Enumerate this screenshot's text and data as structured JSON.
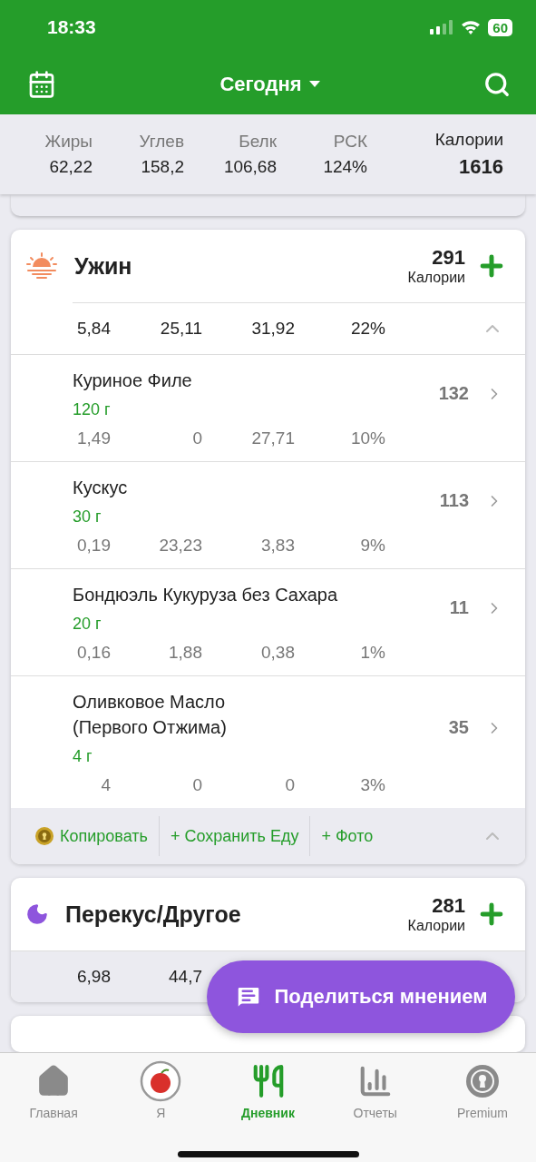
{
  "status_bar": {
    "time": "18:33",
    "battery": "60"
  },
  "header": {
    "title": "Сегодня"
  },
  "summary": [
    {
      "kind": "macro",
      "label": "Жиры",
      "value": "62,22"
    },
    {
      "kind": "macro",
      "label": "Углев",
      "value": "158,2"
    },
    {
      "kind": "macro",
      "label": "Белк",
      "value": "106,68"
    },
    {
      "kind": "macro",
      "label": "РСК",
      "value": "124%"
    },
    {
      "kind": "total",
      "label": "Калории",
      "value": "1616"
    }
  ],
  "meals": [
    {
      "name": "Ужин",
      "kind": "sunset",
      "calories": "291",
      "calories_label": "Калории",
      "expanded": true,
      "totals": [
        "5,84",
        "25,11",
        "31,92",
        "22%"
      ],
      "items": [
        {
          "name": "Куриное Филе",
          "amount": "120 г",
          "calories": "132",
          "values": [
            "1,49",
            "0",
            "27,71",
            "10%"
          ]
        },
        {
          "name": "Кускус",
          "amount": "30 г",
          "calories": "113",
          "values": [
            "0,19",
            "23,23",
            "3,83",
            "9%"
          ]
        },
        {
          "name": "Бондюэль Кукуруза без Сахара",
          "amount": "20 г",
          "calories": "11",
          "values": [
            "0,16",
            "1,88",
            "0,38",
            "1%"
          ]
        },
        {
          "name": "Оливковое Масло\n(Первого Отжима)",
          "amount": "4 г",
          "calories": "35",
          "values": [
            "4",
            "0",
            "0",
            "3%"
          ]
        }
      ],
      "actions": [
        {
          "kind": "copy",
          "label": "Копировать"
        },
        {
          "kind": "save",
          "label": "+ Сохранить Еду"
        },
        {
          "kind": "photo",
          "label": "+ Фото"
        }
      ]
    },
    {
      "name": "Перекус/Другое",
      "kind": "moon",
      "calories": "281",
      "calories_label": "Калории",
      "totals": [
        "6,98",
        "44,7"
      ]
    }
  ],
  "feedback_button": {
    "label": "Поделиться мнением"
  },
  "tabs": [
    {
      "kind": "home",
      "label": "Главная",
      "selected": false
    },
    {
      "kind": "me",
      "label": "Я",
      "selected": false
    },
    {
      "kind": "diary",
      "label": "Дневник",
      "selected": true
    },
    {
      "kind": "reports",
      "label": "Отчеты",
      "selected": false
    },
    {
      "kind": "premium",
      "label": "Premium",
      "selected": false
    }
  ]
}
